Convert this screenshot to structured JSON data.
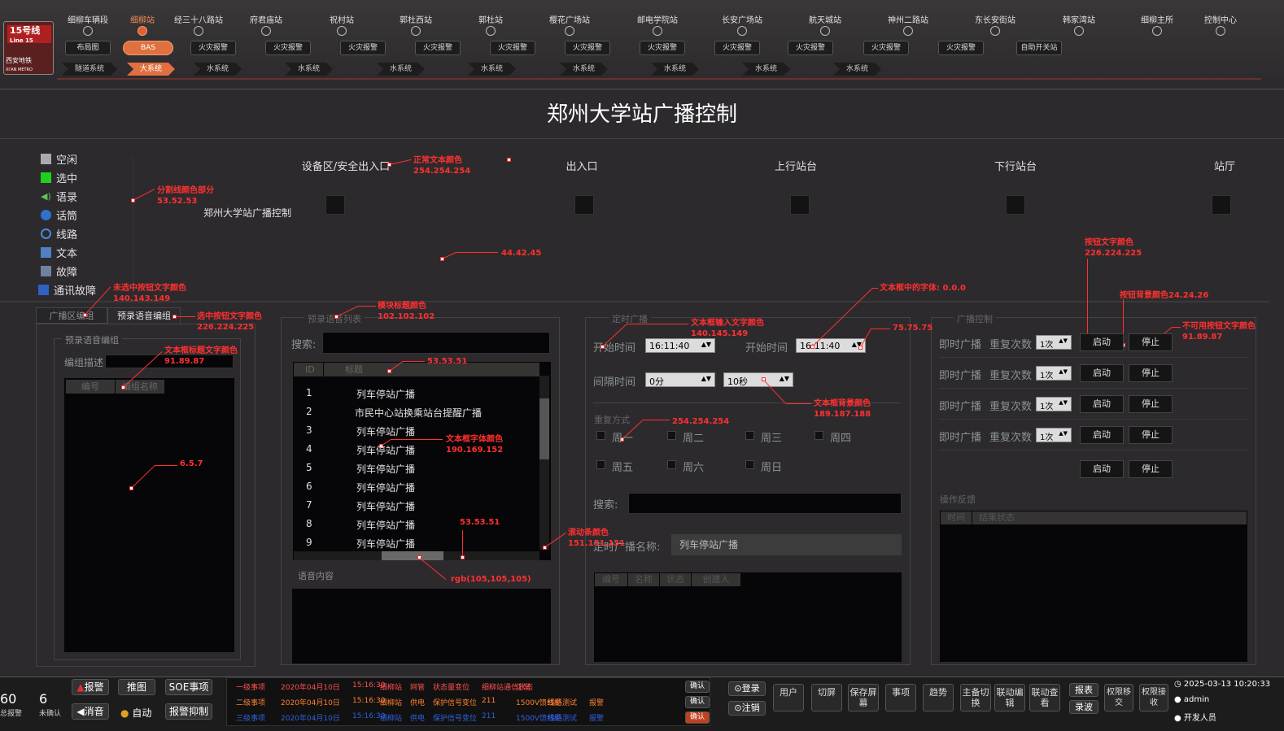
{
  "header": {
    "line_badge": "15号线",
    "line_badge_en": "Line 15",
    "logo_text": "西安地铁",
    "logo_text_en": "XI'AN METRO"
  },
  "stations": [
    {
      "name": "细柳车辆段",
      "dot": true
    },
    {
      "name": "细柳站",
      "dot": true,
      "selected": true
    },
    {
      "name": "经三十八路站",
      "dot": true
    },
    {
      "name": "府君庙站",
      "dot": true
    },
    {
      "name": "祝村站",
      "dot": true
    },
    {
      "name": "郭杜西站",
      "dot": true
    },
    {
      "name": "郭杜站",
      "dot": true
    },
    {
      "name": "樱花广场站",
      "dot": true
    },
    {
      "name": "邮电学院站",
      "dot": true
    },
    {
      "name": "长安广场站",
      "dot": true
    },
    {
      "name": "航天城站",
      "dot": true
    },
    {
      "name": "神州二路站",
      "dot": true
    },
    {
      "name": "东长安街站",
      "dot": true
    },
    {
      "name": "韩家湾站",
      "dot": true
    },
    {
      "name": "细柳主所",
      "dot": true
    },
    {
      "name": "控制中心",
      "dot": true
    }
  ],
  "top_buttons": [
    "布局图",
    "BAS",
    "火灾报警",
    "火灾报警",
    "火灾报警",
    "火灾报警",
    "火灾报警",
    "火灾报警",
    "火灾报警",
    "火灾报警",
    "火灾报警",
    "火灾报警",
    "火灾报警",
    "自助开关站"
  ],
  "sub_systems": [
    "隧道系统",
    "大系统",
    "水系统",
    "水系统",
    "水系统",
    "水系统",
    "水系统",
    "水系统",
    "水系统",
    "水系统"
  ],
  "page_title": "郑州大学站广播控制",
  "legend": [
    "空闲",
    "选中",
    "语录",
    "话筒",
    "线路",
    "文本",
    "故障",
    "通讯故障"
  ],
  "zones": [
    "设备区/安全出入口",
    "出入口",
    "上行站台",
    "下行站台",
    "站厅"
  ],
  "station_label": "郑州大学站广播控制",
  "left_tabs": {
    "tab1": "广播区编组",
    "tab2": "预录语音编组"
  },
  "left_panel": {
    "title": "预录语音编组",
    "desc_label": "编组描述",
    "col1": "编号",
    "col2": "编组名称"
  },
  "voice_list": {
    "title": "预录语音列表",
    "search_label": "搜索:",
    "col_id": "ID",
    "col_title": "标题",
    "rows": [
      [
        "1",
        "列车停站广播"
      ],
      [
        "2",
        "市民中心站换乘站台提醒广播"
      ],
      [
        "3",
        "列车停站广播"
      ],
      [
        "4",
        "列车停站广播"
      ],
      [
        "5",
        "列车停站广播"
      ],
      [
        "6",
        "列车停站广播"
      ],
      [
        "7",
        "列车停站广播"
      ],
      [
        "8",
        "列车停站广播"
      ],
      [
        "9",
        "列车停站广播"
      ]
    ],
    "content_label": "语音内容"
  },
  "timed": {
    "title": "定时广播",
    "start_label": "开始时间",
    "start_value": "16:11:40",
    "start_label2": "开始时间",
    "start_value2": "16:11:40",
    "interval_label": "间隔时间",
    "interval_value": "0分",
    "interval_value2": "10秒",
    "repeat_label": "重复方式",
    "days": [
      "周一",
      "周二",
      "周三",
      "周四",
      "周五",
      "周六",
      "周日"
    ],
    "search_label": "搜索:",
    "name_label": "定时广播名称:",
    "name_value": "列车停站广播",
    "cols": [
      "编号",
      "名称",
      "状态",
      "创建人"
    ]
  },
  "control": {
    "title": "广播控制",
    "rows": [
      {
        "label": "即时广播",
        "repeat": "重复次数",
        "count": "1次"
      },
      {
        "label": "即时广播",
        "repeat": "重复次数",
        "count": "1次"
      },
      {
        "label": "即时广播",
        "repeat": "重复次数",
        "count": "1次"
      },
      {
        "label": "即时广播",
        "repeat": "重复次数",
        "count": "1次"
      }
    ],
    "start": "启动",
    "stop": "停止",
    "feedback_title": "操作反馈",
    "feedback_cols": [
      "时间",
      "结果状态"
    ]
  },
  "annotations": [
    "正常文本颜色",
    "254.254.254",
    "分割线颜色部分",
    "53.52.53",
    "44.42.45",
    "未选中按钮文字颜色",
    "140.143.149",
    "选中按钮文字颜色",
    "226.224.225",
    "模块标题颜色",
    "102.102.102",
    "文本框标题文字颜色",
    "91.89.87",
    "53.53.51",
    "6.5.7",
    "文本框中的字体: 0.0.0",
    "文本框输入文字颜色",
    "140.145.149",
    "75.75.75",
    "文本框背景颜色",
    "189.187.188",
    "文本框字体颜色",
    "190.169.152",
    "254.254.254",
    "53.53.51",
    "滚动条颜色",
    "151.151.151",
    "rgb(105,105,105)",
    "按钮文字颜色",
    "226.224.225",
    "按钮背景颜色24.24.26",
    "不可用按钮文字颜色",
    "91.89.87"
  ],
  "bottom": {
    "count1": "60",
    "count1_label": "总报警",
    "count2": "6",
    "count2_label": "未确认",
    "btn_alarm": "报警",
    "btn_push": "推图",
    "btn_soe": "SOE事项",
    "btn_mute": "消音",
    "btn_auto": "自动",
    "btn_suppress": "报警抑制",
    "alarms": [
      [
        "一级事项",
        "2020年04月10日",
        "15:16:30",
        "细柳站",
        "网管",
        "状态量变位",
        "细柳站通信状态",
        "正常"
      ],
      [
        "二级事项",
        "2020年04月10日",
        "15:16:30",
        "细柳站",
        "供电",
        "保护信号变位",
        "211",
        "1500V馈线柜",
        "线路测试",
        "报警"
      ],
      [
        "三级事项",
        "2020年04月10日",
        "15:16:30",
        "细柳站",
        "供电",
        "保护信号变位",
        "211",
        "1500V馈线柜",
        "线路测试",
        "报警"
      ]
    ],
    "confirm": "确认",
    "login": "登录",
    "logout": "注销",
    "ctrl_buttons": [
      "用户",
      "切屏",
      "保存屏幕",
      "事项",
      "趋势",
      "主备切换",
      "联动编辑",
      "联动查看"
    ],
    "report": "报表",
    "record": "录波",
    "perm_transfer": "权限移交",
    "perm_receive": "权限接收",
    "datetime": "2025-03-13 10:20:33",
    "user": "admin",
    "role": "开发人员"
  }
}
